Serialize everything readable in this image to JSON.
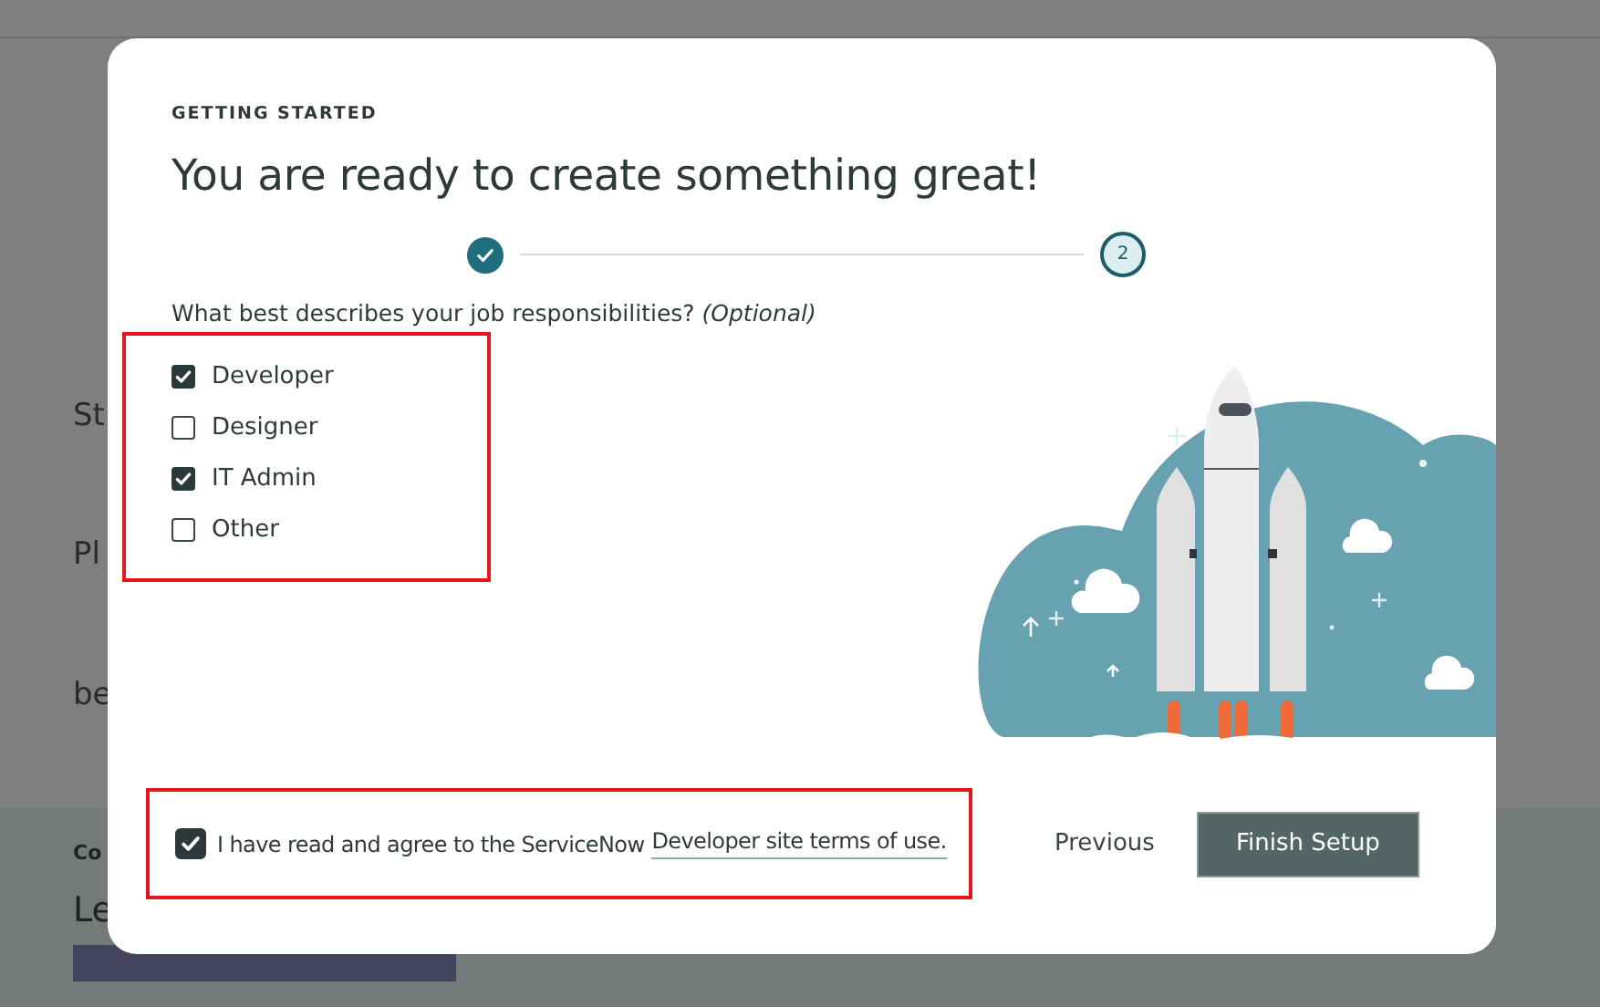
{
  "background": {
    "fragments": [
      {
        "text": "St",
        "kind": "body"
      },
      {
        "text": "Pl",
        "kind": "body"
      },
      {
        "text": "be",
        "kind": "body"
      }
    ],
    "lower_fragments": [
      {
        "text": "Co",
        "kind": "label"
      },
      {
        "text": "Le",
        "kind": "subheading"
      }
    ]
  },
  "dialog": {
    "eyebrow": "GETTING STARTED",
    "title": "You are ready to create something great!",
    "steps": [
      {
        "done": true
      },
      {
        "label": "2",
        "done": false
      }
    ],
    "question": "What best describes your job responsibilities?",
    "question_note": "(Optional)",
    "options": [
      {
        "label": "Developer",
        "checked": true
      },
      {
        "label": "Designer",
        "checked": false
      },
      {
        "label": "IT Admin",
        "checked": true
      },
      {
        "label": "Other",
        "checked": false
      }
    ],
    "agreement": {
      "checked": true,
      "text": "I have read and agree to the ServiceNow",
      "link": "Developer site terms of use."
    },
    "buttons": {
      "previous": "Previous",
      "finish": "Finish Setup"
    }
  }
}
